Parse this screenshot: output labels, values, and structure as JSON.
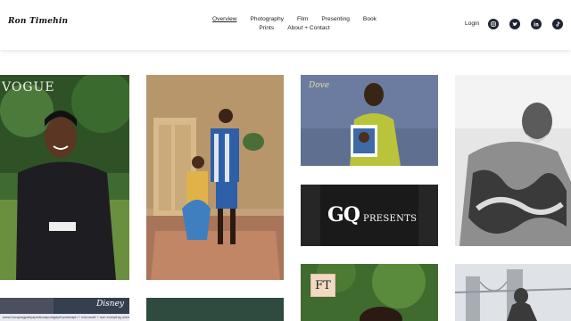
{
  "header": {
    "logo": "Ron Timehin",
    "nav_row1": [
      "Overview",
      "Photography",
      "Film",
      "Presenting",
      "Book"
    ],
    "nav_row2": [
      "Prints",
      "About + Contact"
    ],
    "login": "Login",
    "social_icons": [
      "instagram-icon",
      "twitter-icon",
      "linkedin-icon",
      "tiktok-icon"
    ]
  },
  "gallery": {
    "vogue_text": "VOGUE",
    "dove_text": "Dove",
    "gq_logo": "GQ",
    "gq_sub": "PRESENTS",
    "ft_text": "FT",
    "disney_text": "Disney",
    "caption": "www.hxcquagyahyaplotwoapodigdyhhplotwaph + microsoft + son everythig unlocked"
  },
  "colors": {
    "header_bg": "#ffffff",
    "icon_bg": "#1f2430",
    "gq_bg": "#1a1a1a"
  }
}
